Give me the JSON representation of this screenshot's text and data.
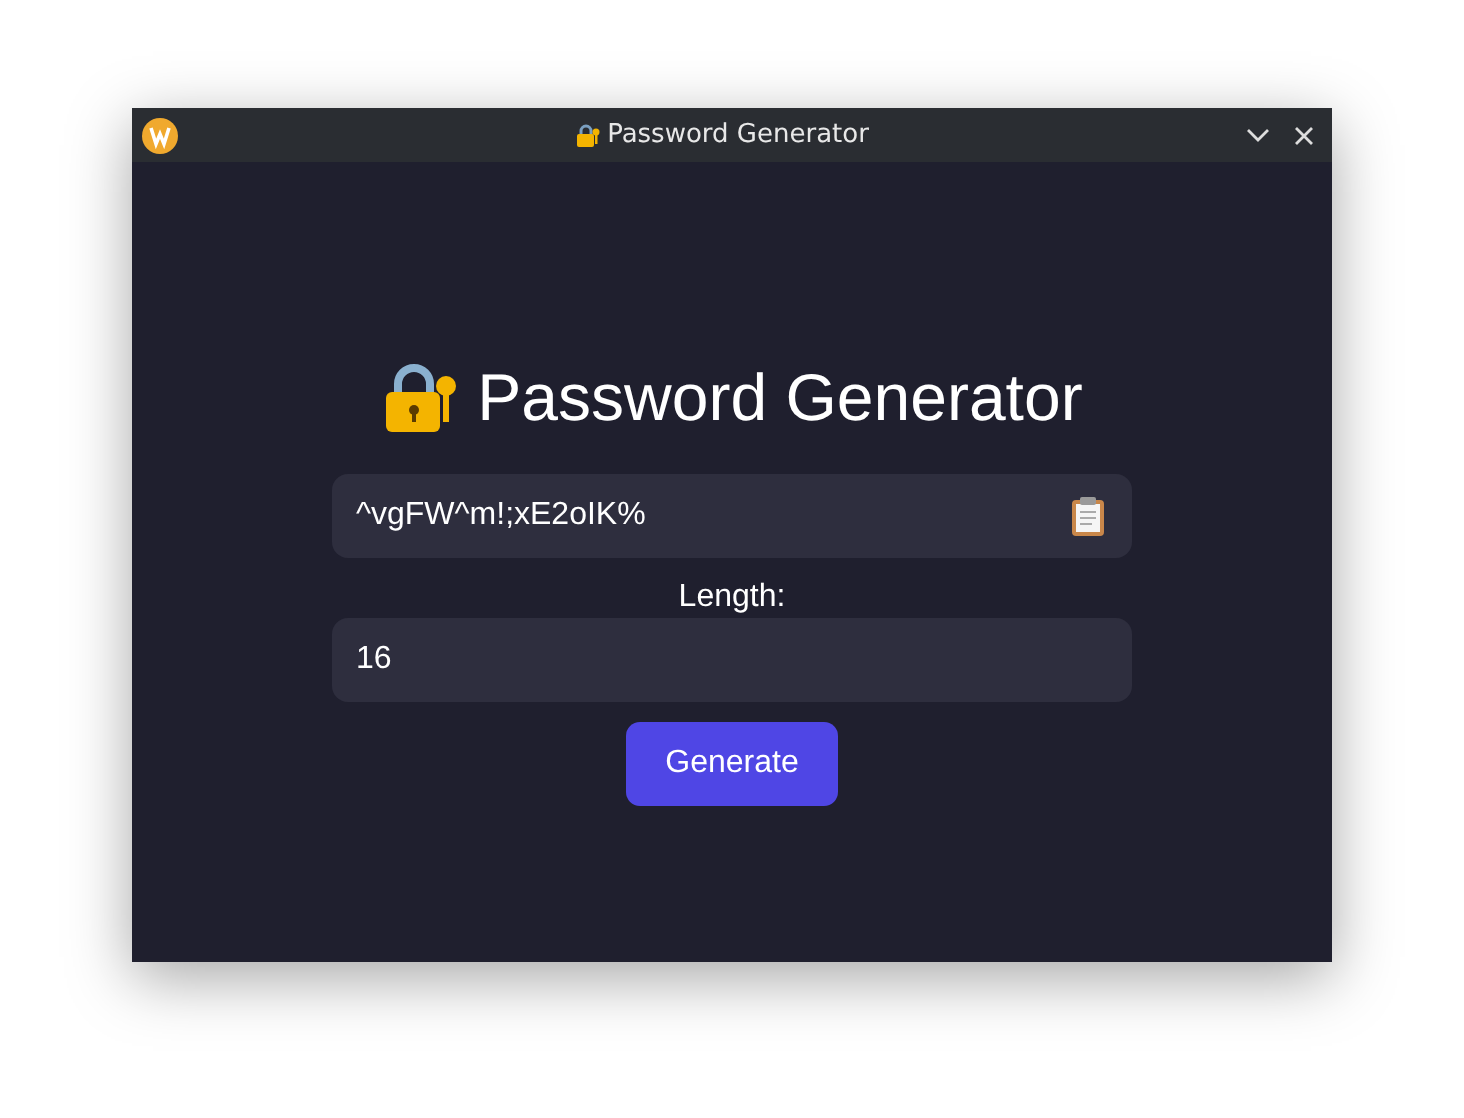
{
  "window": {
    "title": "Password Generator"
  },
  "heading": "Password Generator",
  "password": {
    "value": "^vgFW^m!;xE2oIK%"
  },
  "length": {
    "label": "Length:",
    "value": "16"
  },
  "buttons": [
    "Generate"
  ]
}
